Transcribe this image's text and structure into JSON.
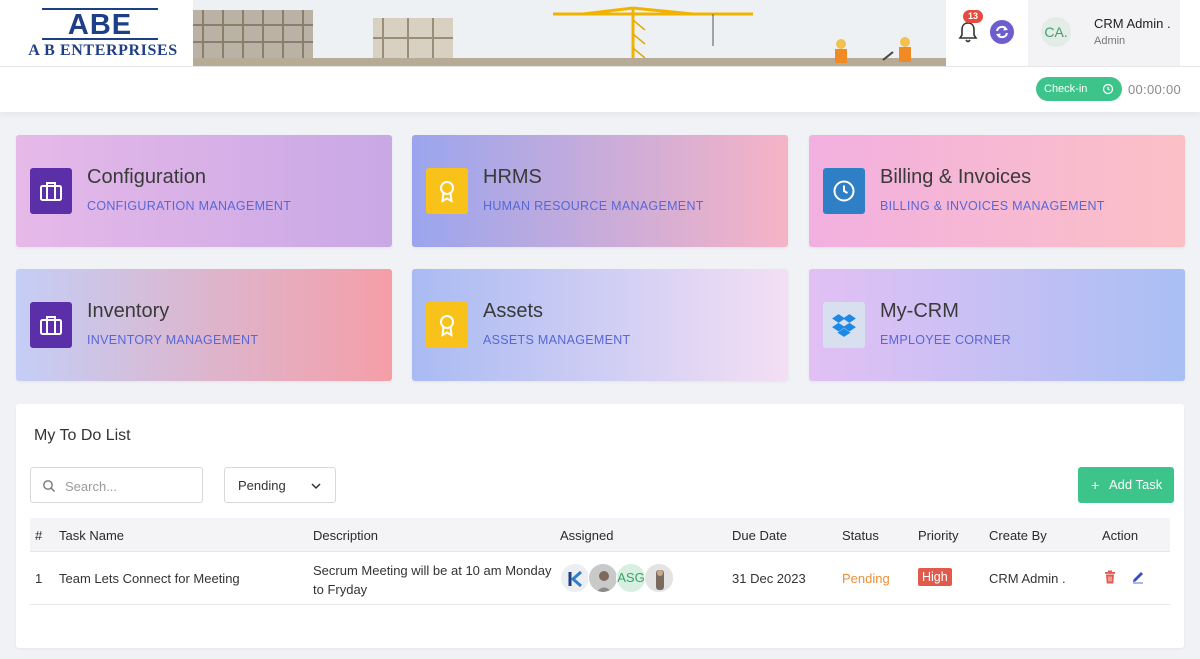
{
  "header": {
    "logo_mark": "ABE",
    "logo_text": "A B ENTERPRISES",
    "notification_count": "13",
    "user": {
      "initials": "CA.",
      "name": "CRM Admin .",
      "role": "Admin"
    }
  },
  "subbar": {
    "checkin_label": "Check-in",
    "timer": "00:00:00"
  },
  "modules": [
    {
      "title": "Configuration",
      "subtitle": "CONFIGURATION MANAGEMENT",
      "icon": "briefcase-icon"
    },
    {
      "title": "HRMS",
      "subtitle": "HUMAN RESOURCE MANAGEMENT",
      "icon": "award-icon"
    },
    {
      "title": "Billing & Invoices",
      "subtitle": "BILLING & INVOICES MANAGEMENT",
      "icon": "clock-icon"
    },
    {
      "title": "Inventory",
      "subtitle": "INVENTORY MANAGEMENT",
      "icon": "briefcase-icon"
    },
    {
      "title": "Assets",
      "subtitle": "ASSETS MANAGEMENT",
      "icon": "award-icon"
    },
    {
      "title": "My-CRM",
      "subtitle": "EMPLOYEE CORNER",
      "icon": "dropbox-icon"
    }
  ],
  "todo": {
    "title": "My To Do List",
    "search_placeholder": "Search...",
    "filter_selected": "Pending",
    "add_label": "Add Task",
    "columns": [
      "#",
      "Task Name",
      "Description",
      "Assigned",
      "Due Date",
      "Status",
      "Priority",
      "Create By",
      "Action"
    ],
    "rows": [
      {
        "index": "1",
        "task_name": "Team Lets Connect for Meeting",
        "description": "Secrum Meeting will be at 10 am Monday to Fryday",
        "assigned_text": "ASG",
        "due_date": "31 Dec 2023",
        "status": "Pending",
        "priority": "High",
        "created_by": "CRM Admin ."
      }
    ]
  },
  "colors": {
    "primary": "#5767d6",
    "success": "#3cc48a",
    "danger": "#e05a4e",
    "warning": "#e8913a",
    "brand": "#1e3f86"
  }
}
